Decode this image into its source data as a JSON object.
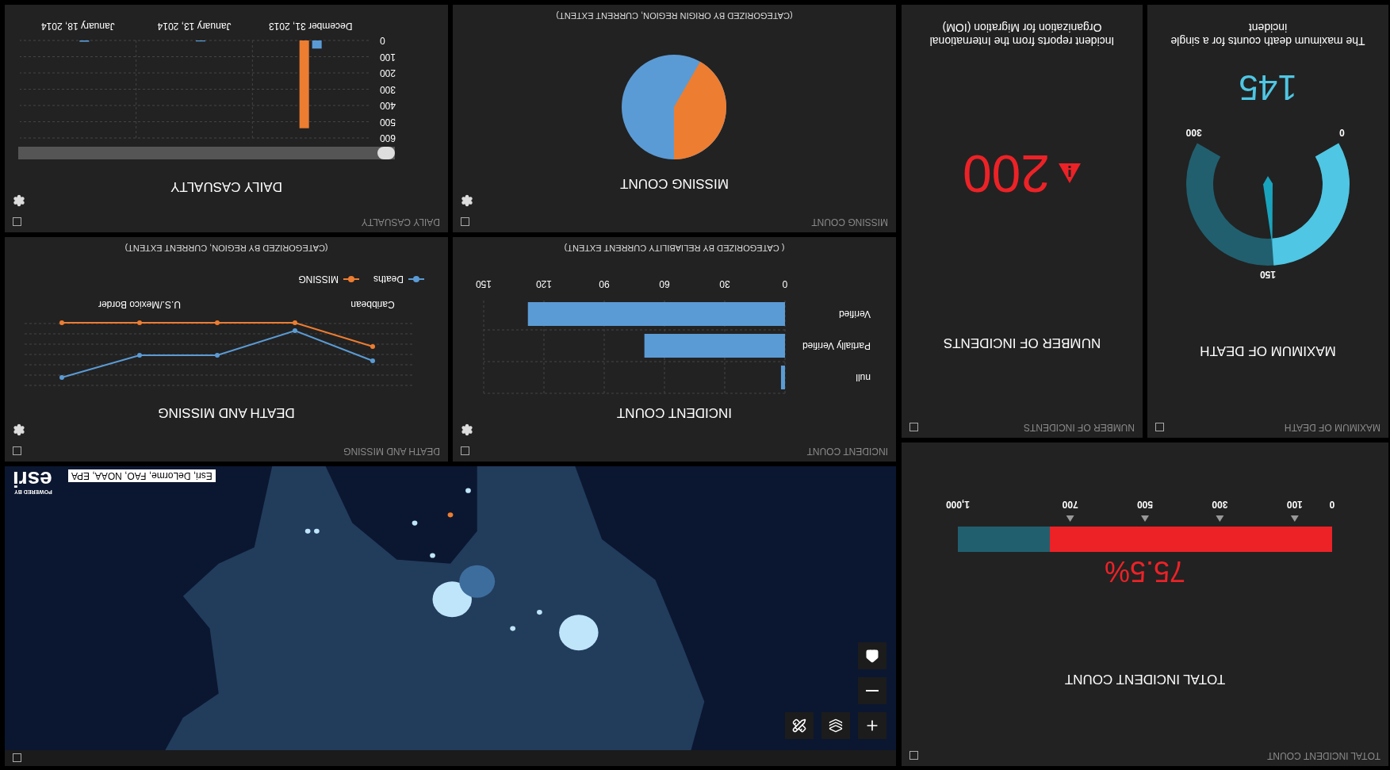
{
  "total_incident_count": {
    "header": "TOTAL INCIDENT COUNT",
    "title": "TOTAL INCIDENT COUNT",
    "value": "75.5%",
    "level": 0.755,
    "scale_labels": [
      "0",
      "100",
      "300",
      "500",
      "700",
      "1,000"
    ]
  },
  "map": {
    "attribution": "Esri, DeLorme, FAO, NOAA, EPA",
    "logo_caption": "POWERED BY",
    "logo": "esri"
  },
  "maximum_of_death": {
    "header": "MAXIMUM OF DEATH",
    "title": "MAXIMUM OF DEATH",
    "scale_labels": [
      "0",
      "150",
      "300"
    ],
    "level": 0.483,
    "value": "145",
    "description": "The maximum death counts for a single incident"
  },
  "number_of_incidents": {
    "header": "NUMBER OF INCIDENTS",
    "title": "NUMBER OF INCIDENTS",
    "value": "200",
    "description": "Incident reports from the International Organization for Migration (IOM)"
  },
  "incident_count": {
    "header": "INCIDENT COUNT",
    "title": "INCIDENT COUNT",
    "subtitle": "( CATEGORIZED BY RELIABILITY CURRENT EXTENT)",
    "chart_data": {
      "type": "bar",
      "orientation": "horizontal",
      "categories": [
        "Verified",
        "Partially Verified",
        "null"
      ],
      "values": [
        128,
        70,
        2
      ],
      "xlim": [
        150,
        0
      ],
      "xticks": [
        150,
        120,
        90,
        60,
        30,
        0
      ],
      "grid": true
    }
  },
  "death_and_missing": {
    "header": "DEATH AND MISSING",
    "title": "DEATH AND MISSING",
    "x_labels": [
      "Caribbean",
      "U.S./Mexico Border"
    ],
    "legend": [
      {
        "label": "Deaths",
        "color": "#5b9bd5"
      },
      {
        "label": "MISSING",
        "color": "#ed7d31"
      }
    ],
    "subtitle": "(CATEGORIZED BY REGION, CURRENT EXTENT)"
  },
  "missing_count": {
    "header": "MISSING COUNT",
    "title": "MISSING COUNT",
    "subtitle": "(CATEGORIZED BY ORIGIN REGION, CURRENT EXTENT)"
  },
  "daily_casualty": {
    "header": "DAILY CASUALTY",
    "title": "DAILY CASUALTY",
    "y_axis_labels": [
      "0",
      "100",
      "200",
      "300",
      "400",
      "500",
      "600"
    ],
    "date_labels": [
      "January 18, 2014",
      "January 13, 2014",
      "December 31, 2013"
    ]
  }
}
